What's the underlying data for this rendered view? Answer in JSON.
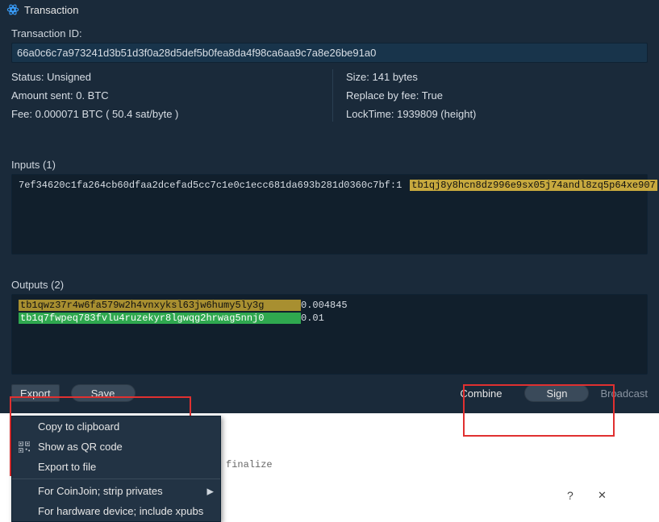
{
  "title": "Transaction",
  "txid_label": "Transaction ID:",
  "txid": "66a0c6c7a973241d3b51d3f0a28d5def5b0fea8da4f98ca6aa9c7a8e26be91a0",
  "left_meta": {
    "status": "Status: Unsigned",
    "amount": "Amount sent: 0. BTC",
    "fee": "Fee: 0.000071 BTC ( 50.4 sat/byte )"
  },
  "right_meta": {
    "size": "Size: 141 bytes",
    "rbf": "Replace by fee: True",
    "locktime": "LockTime: 1939809 (height)"
  },
  "inputs": {
    "header": "Inputs (1)",
    "rows": [
      {
        "outpoint": "7ef34620c1fa264cb60dfaa2dcefad5cc7c1e0c1ecc681da693b281d0360c7bf:1",
        "address": "tb1qj8y8hcn8dz996e9sx05j74andl8zq5p64xe907"
      }
    ]
  },
  "outputs": {
    "header": "Outputs (2)",
    "rows": [
      {
        "address": "tb1qwz37r4w6fa579w2h4vnxyksl63jw6humy5ly3g",
        "amount": "0.004845",
        "cls": "addr-yellow2"
      },
      {
        "address": "tb1q7fwpeq783fvlu4ruzekyr8lgwqg2hrwag5nnj0",
        "amount": "0.01",
        "cls": "addr-green"
      }
    ]
  },
  "buttons": {
    "export": "Export",
    "save": "Save",
    "combine": "Combine",
    "sign": "Sign",
    "broadcast": "Broadcast"
  },
  "menu": {
    "copy": "Copy to clipboard",
    "qr": "Show as QR code",
    "file": "Export to file",
    "coinjoin": "For CoinJoin; strip privates",
    "hw": "For hardware device; include xpubs"
  },
  "ghost_text": "finalize",
  "help_icon": "?",
  "close_icon": "✕"
}
